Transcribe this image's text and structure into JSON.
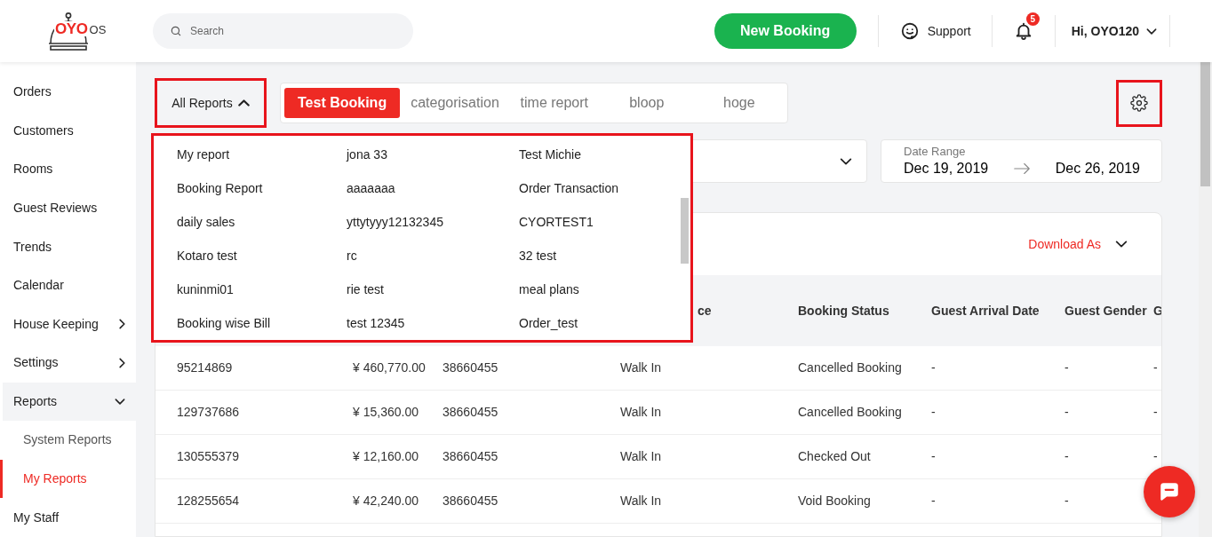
{
  "header": {
    "logo": {
      "brand": "OYO",
      "suffix": "OS"
    },
    "search": {
      "placeholder": "Search"
    },
    "new_booking": "New Booking",
    "support": "Support",
    "notifications": {
      "count": "5"
    },
    "user": "Hi, OYO120"
  },
  "sidebar": {
    "items": [
      {
        "label": "Orders",
        "kind": "link"
      },
      {
        "label": "Customers",
        "kind": "link"
      },
      {
        "label": "Rooms",
        "kind": "link"
      },
      {
        "label": "Guest Reviews",
        "kind": "link"
      },
      {
        "label": "Trends",
        "kind": "link"
      },
      {
        "label": "Calendar",
        "kind": "link"
      },
      {
        "label": "House Keeping",
        "kind": "group",
        "expanded": false
      },
      {
        "label": "Settings",
        "kind": "group",
        "expanded": false
      },
      {
        "label": "Reports",
        "kind": "group",
        "expanded": true,
        "children": [
          {
            "label": "System Reports",
            "selected": false
          },
          {
            "label": "My Reports",
            "selected": true
          }
        ]
      },
      {
        "label": "My Staff",
        "kind": "link"
      }
    ]
  },
  "report_picker": {
    "label": "All Reports",
    "open": true,
    "highlighted": true
  },
  "report_tabs": [
    {
      "label": "Test Booking",
      "selected": true
    },
    {
      "label": "categorisation",
      "selected": false
    },
    {
      "label": "time report",
      "selected": false
    },
    {
      "label": "bloop",
      "selected": false
    },
    {
      "label": "hoge",
      "selected": false
    }
  ],
  "settings_button": {
    "highlighted": true
  },
  "report_menu": {
    "highlighted": true,
    "items": [
      "My report",
      "jona 33",
      "Test Michie",
      "Booking Report",
      "aaaaaaa",
      "Order Transaction",
      "daily sales",
      "yttytyyy12132345",
      "CYORTEST1",
      "Kotaro test",
      "rc",
      "32 test",
      "kuninmi01",
      "rie test",
      "meal plans",
      "Booking wise Bill",
      "test 12345",
      "Order_test"
    ]
  },
  "date_range": {
    "label": "Date Range",
    "from": "Dec 19, 2019",
    "to": "Dec 26, 2019"
  },
  "table": {
    "download": "Download As",
    "columns": [
      "",
      "",
      "",
      "ce",
      "Booking Status",
      "Guest Arrival Date",
      "Guest Gender",
      "G"
    ],
    "rows": [
      [
        "95214869",
        "¥ 460,770.00",
        "38660455",
        "Walk In",
        "Cancelled Booking",
        "-",
        "-",
        "-"
      ],
      [
        "129737686",
        "¥ 15,360.00",
        "38660455",
        "Walk In",
        "Cancelled Booking",
        "-",
        "-",
        "-"
      ],
      [
        "130555379",
        "¥ 12,160.00",
        "38660455",
        "Walk In",
        "Checked Out",
        "-",
        "-",
        "-"
      ],
      [
        "128255654",
        "¥ 42,240.00",
        "38660455",
        "Walk In",
        "Void Booking",
        "-",
        "-"
      ]
    ]
  }
}
